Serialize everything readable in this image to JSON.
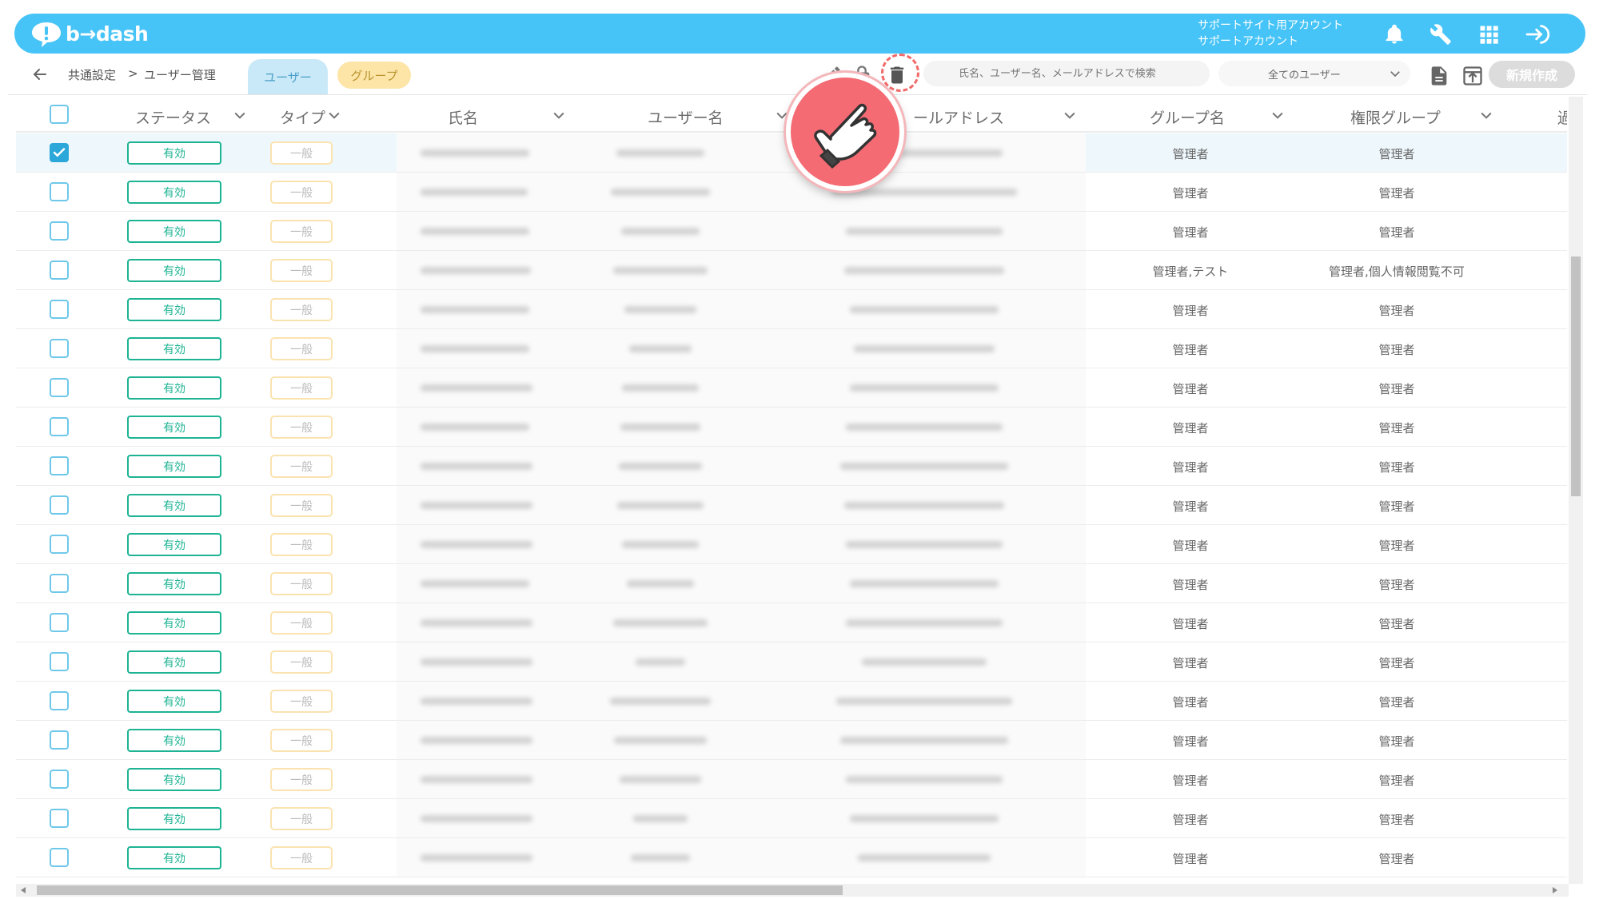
{
  "header": {
    "logo_text": "b→dash",
    "account_line1": "サポートサイト用アカウント",
    "account_line2": "サポートアカウント",
    "icons": [
      "bell-icon",
      "wrench-icon",
      "apps-grid-icon",
      "logout-icon"
    ]
  },
  "toolbar": {
    "breadcrumb_parent": "共通設定",
    "breadcrumb_separator": ">",
    "breadcrumb_current": "ユーザー管理",
    "tab_user": "ユーザー",
    "tab_group": "グループ",
    "search_placeholder": "氏名、ユーザー名、メールアドレスで検索",
    "filter_value": "全てのユーザー",
    "new_button": "新規作成"
  },
  "table": {
    "columns": {
      "status": "ステータス",
      "type": "タイプ",
      "full_name": "氏名",
      "username": "ユーザー名",
      "email": "ールアドレス",
      "group": "グループ名",
      "permission": "権限グループ",
      "extra": "過"
    },
    "status_label": "有効",
    "type_label": "一般",
    "rows": [
      {
        "checked": true,
        "group": "管理者",
        "permission": "管理者"
      },
      {
        "checked": false,
        "group": "管理者",
        "permission": "管理者"
      },
      {
        "checked": false,
        "group": "管理者",
        "permission": "管理者"
      },
      {
        "checked": false,
        "group": "管理者,テスト",
        "permission": "管理者,個人情報閲覧不可"
      },
      {
        "checked": false,
        "group": "管理者",
        "permission": "管理者"
      },
      {
        "checked": false,
        "group": "管理者",
        "permission": "管理者"
      },
      {
        "checked": false,
        "group": "管理者",
        "permission": "管理者"
      },
      {
        "checked": false,
        "group": "管理者",
        "permission": "管理者"
      },
      {
        "checked": false,
        "group": "管理者",
        "permission": "管理者"
      },
      {
        "checked": false,
        "group": "管理者",
        "permission": "管理者"
      },
      {
        "checked": false,
        "group": "管理者",
        "permission": "管理者"
      },
      {
        "checked": false,
        "group": "管理者",
        "permission": "管理者"
      },
      {
        "checked": false,
        "group": "管理者",
        "permission": "管理者"
      },
      {
        "checked": false,
        "group": "管理者",
        "permission": "管理者"
      },
      {
        "checked": false,
        "group": "管理者",
        "permission": "管理者"
      },
      {
        "checked": false,
        "group": "管理者",
        "permission": "管理者"
      },
      {
        "checked": false,
        "group": "管理者",
        "permission": "管理者"
      },
      {
        "checked": false,
        "group": "管理者",
        "permission": "管理者"
      },
      {
        "checked": false,
        "group": "管理者",
        "permission": "管理者"
      }
    ]
  },
  "colors": {
    "brand": "#47c4f7",
    "status_green": "#1db393",
    "type_border": "#fbe3b0",
    "hint_red": "#f46b73"
  }
}
